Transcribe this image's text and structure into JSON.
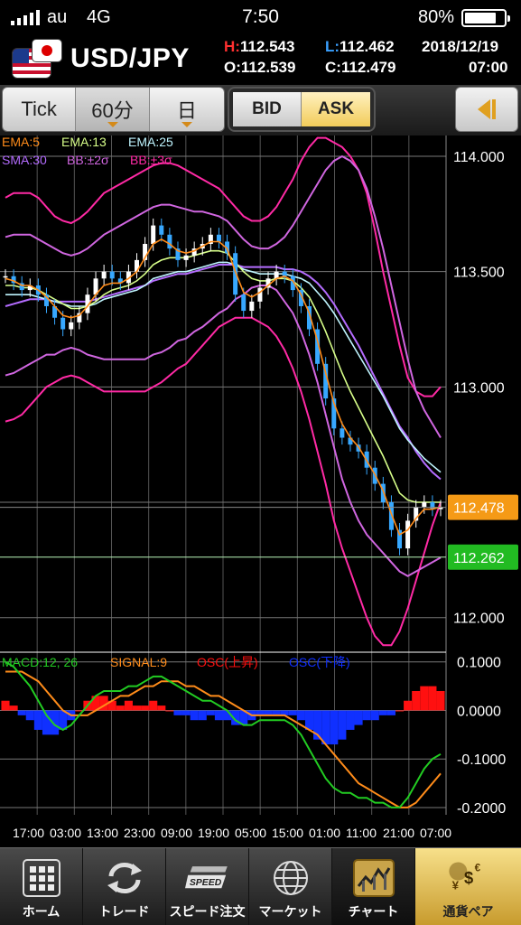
{
  "status_bar": {
    "carrier": "au",
    "network": "4G",
    "time": "7:50",
    "battery": "80%",
    "battery_level": 0.8
  },
  "header": {
    "pair": "USD/JPY",
    "high_label": "H:",
    "high": "112.543",
    "low_label": "L:",
    "low": "112.462",
    "open_label": "O:",
    "open": "112.539",
    "close_label": "C:",
    "close": "112.479",
    "date": "2018/12/19",
    "time": "07:00"
  },
  "toolbar": {
    "tick": "Tick",
    "sixty_min": "60分",
    "day": "日",
    "bid": "BID",
    "ask": "ASK"
  },
  "colors": {
    "ema5": "#ff8c1a",
    "ema13": "#d8ff8a",
    "ema25": "#bff5ff",
    "sma30": "#b46cff",
    "bb2": "#d066e0",
    "bb3": "#ff2aa5",
    "candle_up": "#ffffff",
    "candle_down": "#37a8ff",
    "macd": "#22cc22",
    "signal": "#ff8c1a",
    "osc_up": "#ff1010",
    "osc_down": "#1030ff",
    "current_price": "#f59a16",
    "bid_line": "#22bb22"
  },
  "chart_data": [
    {
      "type": "candlestick",
      "legend": {
        "ema5": "EMA:5",
        "ema13": "EMA:13",
        "ema25": "EMA:25",
        "sma30": "SMA:30",
        "bb2": "BB:±2σ",
        "bb3": "BB:±3σ"
      },
      "y_ticks": [
        "114.000",
        "113.500",
        "113.000",
        "112.500",
        "112.000"
      ],
      "y_tick_values": [
        114.0,
        113.5,
        113.0,
        112.5,
        112.0
      ],
      "ylim": [
        111.85,
        114.09
      ],
      "x_ticks": [
        "17:00",
        "03:00",
        "13:00",
        "23:00",
        "09:00",
        "19:00",
        "05:00",
        "15:00",
        "01:00",
        "11:00",
        "21:00",
        "07:00"
      ],
      "current_price": "112.478",
      "current_price_value": 112.478,
      "bid_line": "112.262",
      "bid_line_value": 112.262,
      "close_series": [
        113.48,
        113.45,
        113.42,
        113.44,
        113.4,
        113.35,
        113.3,
        113.25,
        113.28,
        113.32,
        113.4,
        113.47,
        113.5,
        113.47,
        113.45,
        113.5,
        113.55,
        113.62,
        113.7,
        113.66,
        113.6,
        113.55,
        113.57,
        113.6,
        113.62,
        113.66,
        113.63,
        113.58,
        113.4,
        113.33,
        113.37,
        113.43,
        113.47,
        113.5,
        113.48,
        113.42,
        113.35,
        113.25,
        113.1,
        112.95,
        112.82,
        112.78,
        112.75,
        112.72,
        112.65,
        112.58,
        112.5,
        112.38,
        112.3,
        112.42,
        112.48,
        112.5,
        112.47,
        112.48
      ],
      "ema5": [
        113.47,
        113.46,
        113.44,
        113.44,
        113.42,
        113.39,
        113.35,
        113.31,
        113.3,
        113.31,
        113.35,
        113.4,
        113.44,
        113.45,
        113.45,
        113.47,
        113.5,
        113.56,
        113.62,
        113.64,
        113.62,
        113.59,
        113.58,
        113.59,
        113.61,
        113.63,
        113.63,
        113.6,
        113.5,
        113.41,
        113.39,
        113.41,
        113.44,
        113.47,
        113.48,
        113.46,
        113.4,
        113.32,
        113.2,
        113.06,
        112.93,
        112.84,
        112.78,
        112.74,
        112.68,
        112.62,
        112.55,
        112.45,
        112.36,
        112.38,
        112.43,
        112.47,
        112.47,
        112.48
      ],
      "ema13": [
        113.44,
        113.44,
        113.43,
        113.43,
        113.42,
        113.4,
        113.38,
        113.36,
        113.34,
        113.34,
        113.35,
        113.37,
        113.4,
        113.42,
        113.43,
        113.44,
        113.46,
        113.49,
        113.53,
        113.55,
        113.56,
        113.56,
        113.56,
        113.57,
        113.58,
        113.59,
        113.59,
        113.58,
        113.54,
        113.5,
        113.47,
        113.46,
        113.46,
        113.47,
        113.47,
        113.46,
        113.43,
        113.39,
        113.32,
        113.24,
        113.15,
        113.06,
        112.98,
        112.91,
        112.84,
        112.77,
        112.7,
        112.62,
        112.54,
        112.51,
        112.5,
        112.5,
        112.5,
        112.5
      ],
      "ema25": [
        113.4,
        113.4,
        113.4,
        113.4,
        113.39,
        113.38,
        113.37,
        113.36,
        113.35,
        113.35,
        113.35,
        113.36,
        113.38,
        113.39,
        113.4,
        113.41,
        113.42,
        113.44,
        113.47,
        113.48,
        113.49,
        113.5,
        113.5,
        113.51,
        113.52,
        113.53,
        113.54,
        113.54,
        113.53,
        113.51,
        113.5,
        113.49,
        113.49,
        113.49,
        113.49,
        113.48,
        113.47,
        113.45,
        113.41,
        113.37,
        113.32,
        113.26,
        113.2,
        113.14,
        113.08,
        113.02,
        112.96,
        112.89,
        112.82,
        112.77,
        112.73,
        112.69,
        112.66,
        112.63
      ],
      "sma30": [
        113.35,
        113.36,
        113.37,
        113.38,
        113.38,
        113.38,
        113.37,
        113.37,
        113.37,
        113.37,
        113.37,
        113.38,
        113.39,
        113.4,
        113.41,
        113.42,
        113.43,
        113.44,
        113.46,
        113.47,
        113.48,
        113.49,
        113.49,
        113.5,
        113.51,
        113.52,
        113.53,
        113.53,
        113.53,
        113.52,
        113.52,
        113.52,
        113.52,
        113.52,
        113.51,
        113.51,
        113.5,
        113.48,
        113.45,
        113.41,
        113.36,
        113.3,
        113.24,
        113.18,
        113.11,
        113.04,
        112.97,
        112.9,
        112.83,
        112.78,
        112.72,
        112.67,
        112.63,
        112.6
      ],
      "bb2_upper": [
        113.65,
        113.66,
        113.66,
        113.66,
        113.64,
        113.62,
        113.6,
        113.58,
        113.57,
        113.58,
        113.6,
        113.63,
        113.66,
        113.68,
        113.7,
        113.72,
        113.74,
        113.76,
        113.78,
        113.79,
        113.79,
        113.78,
        113.77,
        113.76,
        113.76,
        113.75,
        113.74,
        113.72,
        113.68,
        113.64,
        113.61,
        113.6,
        113.6,
        113.62,
        113.65,
        113.7,
        113.76,
        113.82,
        113.88,
        113.94,
        113.98,
        114.0,
        113.98,
        113.94,
        113.86,
        113.74,
        113.6,
        113.44,
        113.28,
        113.12,
        112.98,
        112.9,
        112.84,
        112.78
      ],
      "bb2_lower": [
        113.05,
        113.06,
        113.08,
        113.1,
        113.12,
        113.14,
        113.14,
        113.16,
        113.17,
        113.16,
        113.14,
        113.13,
        113.12,
        113.12,
        113.12,
        113.12,
        113.12,
        113.12,
        113.14,
        113.15,
        113.17,
        113.2,
        113.21,
        113.24,
        113.26,
        113.29,
        113.32,
        113.34,
        113.38,
        113.4,
        113.43,
        113.44,
        113.44,
        113.42,
        113.37,
        113.32,
        113.24,
        113.14,
        113.02,
        112.88,
        112.74,
        112.6,
        112.5,
        112.42,
        112.36,
        112.32,
        112.28,
        112.24,
        112.2,
        112.18,
        112.2,
        112.22,
        112.24,
        112.26
      ],
      "bb3_upper": [
        113.82,
        113.84,
        113.84,
        113.84,
        113.82,
        113.78,
        113.74,
        113.72,
        113.71,
        113.73,
        113.76,
        113.8,
        113.84,
        113.86,
        113.88,
        113.9,
        113.92,
        113.94,
        113.96,
        113.97,
        113.97,
        113.96,
        113.94,
        113.92,
        113.9,
        113.88,
        113.86,
        113.82,
        113.78,
        113.74,
        113.72,
        113.72,
        113.74,
        113.78,
        113.84,
        113.9,
        113.98,
        114.04,
        114.08,
        114.08,
        114.06,
        114.04,
        114.0,
        113.94,
        113.84,
        113.68,
        113.5,
        113.34,
        113.18,
        113.04,
        112.98,
        112.96,
        112.96,
        113.0
      ],
      "bb3_lower": [
        112.85,
        112.86,
        112.88,
        112.92,
        112.96,
        113.0,
        113.02,
        113.04,
        113.05,
        113.04,
        113.02,
        113.0,
        112.98,
        112.98,
        112.98,
        112.98,
        112.98,
        112.98,
        113.0,
        113.02,
        113.05,
        113.08,
        113.1,
        113.14,
        113.18,
        113.22,
        113.26,
        113.28,
        113.3,
        113.3,
        113.3,
        113.28,
        113.26,
        113.22,
        113.16,
        113.08,
        112.98,
        112.86,
        112.72,
        112.58,
        112.42,
        112.3,
        112.2,
        112.1,
        112.0,
        111.92,
        111.88,
        111.88,
        111.94,
        112.04,
        112.16,
        112.28,
        112.4,
        112.5
      ]
    },
    {
      "type": "macd",
      "legend": {
        "macd": "MACD:12, 26",
        "signal": "SIGNAL:9",
        "osc_up": "OSC(上昇)",
        "osc_down": "OSC(下降)"
      },
      "y_ticks": [
        "0.1000",
        "0.0000",
        "-0.1000",
        "-0.2000"
      ],
      "y_tick_values": [
        0.1,
        0.0,
        -0.1,
        -0.2
      ],
      "ylim": [
        -0.215,
        0.12
      ],
      "macd": [
        0.1,
        0.09,
        0.07,
        0.05,
        0.02,
        -0.01,
        -0.03,
        -0.04,
        -0.03,
        -0.01,
        0.01,
        0.03,
        0.04,
        0.04,
        0.04,
        0.05,
        0.05,
        0.06,
        0.07,
        0.07,
        0.06,
        0.05,
        0.04,
        0.03,
        0.02,
        0.02,
        0.01,
        0.0,
        -0.02,
        -0.03,
        -0.03,
        -0.02,
        -0.02,
        -0.02,
        -0.02,
        -0.03,
        -0.05,
        -0.08,
        -0.11,
        -0.14,
        -0.16,
        -0.17,
        -0.17,
        -0.18,
        -0.18,
        -0.19,
        -0.19,
        -0.2,
        -0.2,
        -0.18,
        -0.15,
        -0.12,
        -0.1,
        -0.09
      ],
      "signal": [
        0.08,
        0.08,
        0.08,
        0.07,
        0.06,
        0.04,
        0.02,
        0.0,
        -0.01,
        -0.01,
        -0.01,
        0.0,
        0.01,
        0.02,
        0.03,
        0.03,
        0.04,
        0.05,
        0.05,
        0.06,
        0.06,
        0.06,
        0.05,
        0.05,
        0.04,
        0.03,
        0.03,
        0.02,
        0.01,
        0.0,
        -0.01,
        -0.01,
        -0.01,
        -0.01,
        -0.01,
        -0.02,
        -0.03,
        -0.04,
        -0.05,
        -0.07,
        -0.09,
        -0.11,
        -0.13,
        -0.15,
        -0.16,
        -0.17,
        -0.18,
        -0.19,
        -0.2,
        -0.2,
        -0.19,
        -0.17,
        -0.15,
        -0.13
      ],
      "osc": [
        0.02,
        0.01,
        -0.01,
        -0.02,
        -0.04,
        -0.05,
        -0.05,
        -0.04,
        -0.02,
        0.0,
        0.02,
        0.03,
        0.03,
        0.02,
        0.01,
        0.02,
        0.01,
        0.01,
        0.02,
        0.01,
        0.0,
        -0.01,
        -0.01,
        -0.02,
        -0.02,
        -0.01,
        -0.02,
        -0.02,
        -0.03,
        -0.03,
        -0.02,
        -0.01,
        -0.01,
        -0.01,
        -0.01,
        -0.01,
        -0.02,
        -0.04,
        -0.06,
        -0.07,
        -0.07,
        -0.06,
        -0.04,
        -0.03,
        -0.02,
        -0.02,
        -0.01,
        -0.01,
        0.0,
        0.02,
        0.04,
        0.05,
        0.05,
        0.04
      ]
    }
  ],
  "bottom_nav": {
    "home": "ホーム",
    "trade": "トレード",
    "speed": "スピード注文",
    "market": "マーケット",
    "chart": "チャート",
    "pair": "通貨ペア",
    "speed_badge": "SPEED"
  }
}
